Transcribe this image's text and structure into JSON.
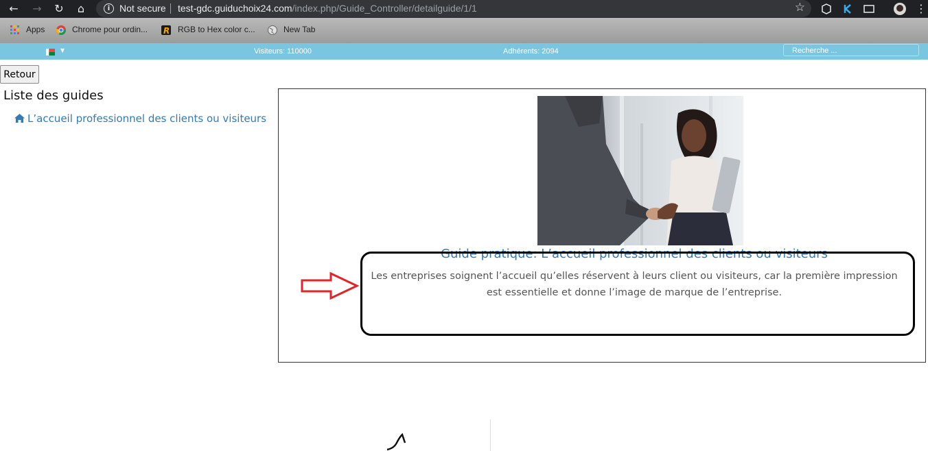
{
  "browser": {
    "security_label": "Not secure",
    "url_host": "test-gdc.guiduchoix24.com",
    "url_path": "/index.php/Guide_Controller/detailguide/1/1",
    "bookmarks": [
      {
        "label": "Apps",
        "icon": "apps-grid-icon"
      },
      {
        "label": "Chrome pour ordin...",
        "icon": "chrome-icon"
      },
      {
        "label": "RGB to Hex color c...",
        "icon": "r-logo-icon"
      },
      {
        "label": "New Tab",
        "icon": "globe-icon"
      }
    ]
  },
  "site_bar": {
    "visitors": "Visiteurs: 110000",
    "members": "Adhérents: 2094",
    "search_placeholder": "Recherche ..."
  },
  "page": {
    "back_button": "Retour",
    "list_title": "Liste des guides",
    "guide_link": "L’accueil professionnel des clients ou visiteurs",
    "guide_title": "Guide pratique: L’accueil professionnel des clients ou visiteurs",
    "guide_description": "Les entreprises soignent l’accueil qu’elles réservent à leurs client ou visiteurs, car la première impression est essentielle et donne l’image de marque de l’entreprise."
  },
  "colors": {
    "site_bar": "#7ac6e0",
    "link": "#337ab7",
    "annotation_arrow": "#e0242a"
  }
}
